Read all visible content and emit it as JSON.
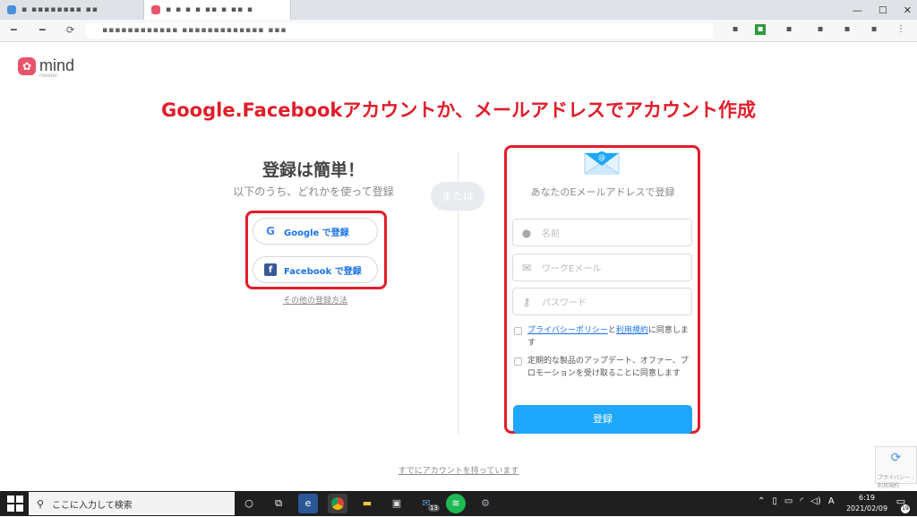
{
  "browser": {
    "tab_inactive_title": "▪ ▪▪▪▪▪▪▪▪ ▪▪",
    "tab_active_title": "▪ ▪ ▪ ▪ ▪▪ ▪ ▪▪ ▪",
    "address": "▪▪▪▪▪▪▪▪▪▪▪▪ ▪▪▪▪▪▪▪▪▪▪▪▪▪ ▪▪▪",
    "window_controls": [
      "—",
      "☐",
      "✕"
    ]
  },
  "logo": {
    "text": "mind",
    "sub": "meister"
  },
  "headline": "Google.Facebookアカウントか、メールアドレスでアカウント作成",
  "signup": {
    "title": "登録は簡単！",
    "subtitle": "以下のうち、どれかを使って登録",
    "google_label": "Google で登録",
    "facebook_label": "Facebook で登録",
    "other_link": "その他の登録方法",
    "or_label": "または"
  },
  "form": {
    "title": "あなたのEメールアドレスで登録",
    "name_placeholder": "名前",
    "email_placeholder": "ワークEメール",
    "password_placeholder": "パスワード",
    "terms_link1": "プライバシーポリシー",
    "terms_and": "と",
    "terms_link2": "利用規約",
    "terms_suffix": "に同意します",
    "promo_text": "定期的な製品のアップデート、オファー、プロモーションを受け取ることに同意します",
    "register_label": "登録"
  },
  "already_link": "すでにアカウントを持っています",
  "recaptcha_label": "プライバシー - 利用規約",
  "taskbar": {
    "search_placeholder": "ここに入力して検索",
    "mail_badge": "13",
    "time": "6:19",
    "date": "2021/02/09",
    "ime": "A",
    "notification_count": "19"
  },
  "colors": {
    "accent_red": "#e01e2b",
    "brand_pink": "#e8546b",
    "primary_blue": "#1ea7fd"
  }
}
